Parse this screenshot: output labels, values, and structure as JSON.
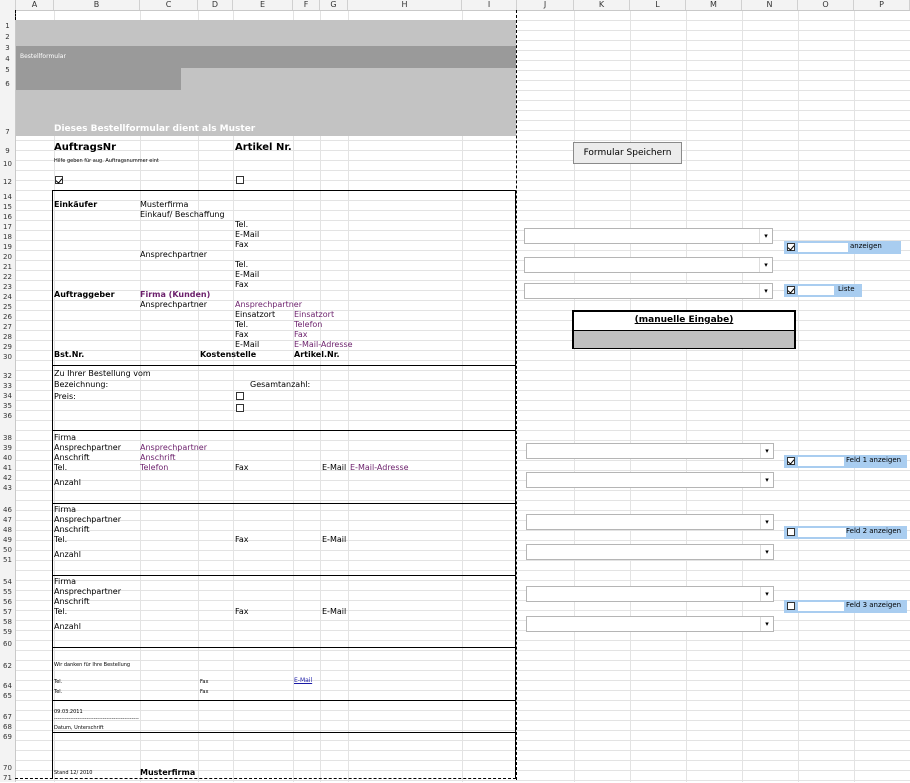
{
  "columns": [
    "A",
    "B",
    "C",
    "D",
    "E",
    "F",
    "G",
    "H",
    "I",
    "J",
    "K",
    "L",
    "M",
    "N",
    "O",
    "P"
  ],
  "rows": [
    "1",
    "2",
    "3",
    "4",
    "5",
    "6",
    "7",
    "9",
    "10",
    "12",
    "14",
    "15",
    "16",
    "17",
    "18",
    "19",
    "20",
    "21",
    "22",
    "23",
    "24",
    "25",
    "26",
    "27",
    "28",
    "29",
    "30",
    "32",
    "33",
    "34",
    "35",
    "36",
    "38",
    "39",
    "40",
    "41",
    "42",
    "43",
    "46",
    "47",
    "48",
    "49",
    "50",
    "51",
    "54",
    "55",
    "56",
    "57",
    "58",
    "59",
    "60",
    "62",
    "64",
    "65",
    "67",
    "68",
    "69",
    "70",
    "71"
  ],
  "form": {
    "header_small": "Bestellformular",
    "banner": "Dieses Bestellformular dient als Muster",
    "auftragsnr": "AuftragsNr",
    "artikel_nr": "Artikel Nr.",
    "hint": "Hilfe geben für aug. Auftragsnummer eint",
    "einkaeufer": "Einkäufer",
    "musterfirma": "Musterfirma",
    "einkauf": "Einkauf/ Beschaffung",
    "tel": "Tel.",
    "email": "E-Mail",
    "fax": "Fax",
    "ansprechpartner": "Ansprechpartner",
    "auftraggeber": "Auftraggeber",
    "firma_kunden": "Firma (Kunden)",
    "einsatzort": "Einsatzort",
    "telefon": "Telefon",
    "email_adresse": "E-Mail-Adresse",
    "bst_nr": "Bst.Nr.",
    "kostenstelle": "Kostenstelle",
    "artikel_nr2": "Artikel.Nr.",
    "zu_ihrer": "Zu Ihrer Bestellung vom",
    "bezeichnung": "Bezeichnung:",
    "gesamtanzahl": "Gesamtanzahl:",
    "preis": "Preis:",
    "firma": "Firma",
    "anschrift": "Anschrift",
    "anzahl": "Anzahl",
    "danke": "Wir danken für Ihre Bestellung",
    "date": "09.03.2011",
    "dashes": "-----------------------------------------------",
    "datum_unterschrift": "Datum, Unterschrift",
    "stand": "Stand 12/ 2010",
    "musterfirma_footer": "Musterfirma"
  },
  "sidebar": {
    "save_button": "Formular Speichern",
    "manual_input": "(manuelle Eingabe)",
    "opt1": "anzeigen",
    "opt2": "Liste",
    "opt3": "Feld 1 anzeigen",
    "opt4": "Feld 2 anzeigen",
    "opt5": "Feld 3 anzeigen",
    "arrow": "▾"
  }
}
